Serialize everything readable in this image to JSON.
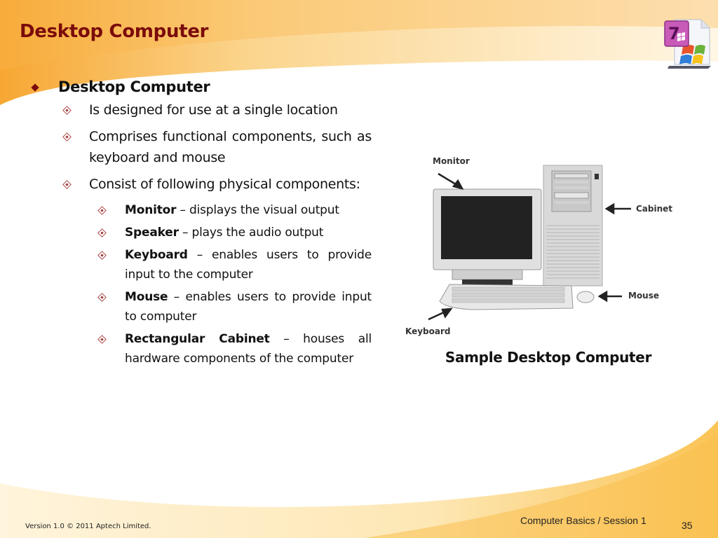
{
  "slide": {
    "title": "Desktop Computer",
    "logo_icon": "windows7-document-icon",
    "colors": {
      "title": "#7a0b0b",
      "accent_gradient": "#f7a733",
      "text": "#111111"
    }
  },
  "content": {
    "heading": "Desktop Computer",
    "points": [
      "Is designed for use at a single location",
      "Comprises functional components, such as keyboard and mouse",
      "Consist of following physical components:"
    ],
    "components": [
      {
        "term": "Monitor",
        "desc": " – displays the visual output"
      },
      {
        "term": "Speaker",
        "desc": " – plays the audio output"
      },
      {
        "term": "Keyboard",
        "desc": " – enables users to provide input to the computer"
      },
      {
        "term": "Mouse",
        "desc": " – enables users to provide input to computer"
      },
      {
        "term": "Rectangular Cabinet",
        "desc": " – houses all hardware components of the computer"
      }
    ]
  },
  "figure": {
    "labels": {
      "monitor": "Monitor",
      "cabinet": "Cabinet",
      "mouse": "Mouse",
      "keyboard": "Keyboard"
    },
    "caption": "Sample Desktop Computer"
  },
  "footer": {
    "version": "Version 1.0 © 2011 Aptech Limited.",
    "course": "Computer Basics / Session 1",
    "page": "35"
  }
}
